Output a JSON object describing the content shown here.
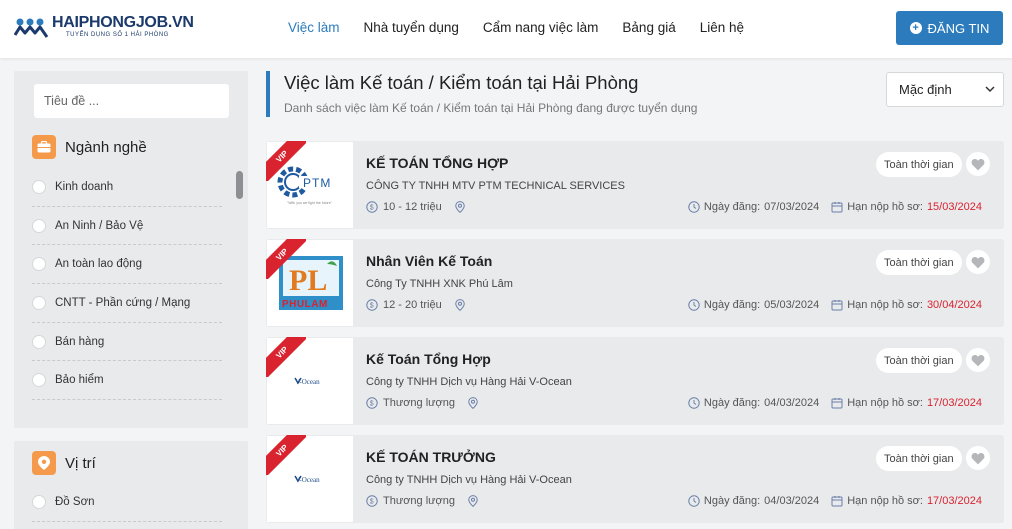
{
  "brand": {
    "name": "HAIPHONGJOB.VN",
    "tagline": "TUYỂN DỤNG SỐ 1 HẢI PHÒNG",
    "accent": "#2b7bbd",
    "navy": "#1b3a6b"
  },
  "nav": {
    "items": [
      {
        "label": "Việc làm",
        "active": true
      },
      {
        "label": "Nhà tuyển dụng",
        "active": false
      },
      {
        "label": "Cẩm nang việc làm",
        "active": false
      },
      {
        "label": "Bảng giá",
        "active": false
      },
      {
        "label": "Liên hệ",
        "active": false
      }
    ],
    "post_button": "ĐĂNG TIN",
    "post_icon": "plus-circle-icon"
  },
  "sidebar": {
    "search": {
      "placeholder": "Tiêu đề ...",
      "value": ""
    },
    "industry": {
      "title": "Ngành nghề",
      "icon": "briefcase-icon",
      "options": [
        "Kinh doanh",
        "An Ninh / Bảo Vệ",
        "An toàn lao động",
        "CNTT - Phần cứng / Mạng",
        "Bán hàng",
        "Bảo hiểm"
      ]
    },
    "location": {
      "title": "Vị trí",
      "icon": "location-pin-icon",
      "options": [
        "Đồ Sơn"
      ]
    }
  },
  "main": {
    "title": "Việc làm Kế toán / Kiểm toán tại Hải Phòng",
    "subtitle": "Danh sách việc làm Kế toán / Kiểm toán tại Hải Phòng đang được tuyển dụng",
    "sort": {
      "selected": "Mặc định"
    },
    "vip_label": "VIP",
    "jobs": [
      {
        "title": "KẾ TOÁN TỔNG HỢP",
        "company": "CÔNG TY TNHH MTV PTM TECHNICAL SERVICES",
        "salary": "10 - 12 triệu",
        "posted_label": "Ngày đăng:",
        "posted": "07/03/2024",
        "deadline_label": "Hạn nộp hồ sơ:",
        "deadline": "15/03/2024",
        "type": "Toàn thời gian",
        "logo": {
          "kind": "ptm",
          "text": "PTM",
          "slogan": "\"With you we fight the future\""
        }
      },
      {
        "title": "Nhân Viên Kế Toán",
        "company": "Công Ty TNHH XNK Phú Lâm",
        "salary": "12 - 20 triệu",
        "posted_label": "Ngày đăng:",
        "posted": "05/03/2024",
        "deadline_label": "Hạn nộp hồ sơ:",
        "deadline": "30/04/2024",
        "type": "Toàn thời gian",
        "logo": {
          "kind": "phulam",
          "text": "PL",
          "slogan": "PHULAM"
        }
      },
      {
        "title": "Kế Toán Tổng Hợp",
        "company": "Công ty TNHH Dịch vụ Hàng Hải V-Ocean",
        "salary": "Thương lượng",
        "posted_label": "Ngày đăng:",
        "posted": "04/03/2024",
        "deadline_label": "Hạn nộp hồ sơ:",
        "deadline": "17/03/2024",
        "type": "Toàn thời gian",
        "logo": {
          "kind": "vocean",
          "text": "V-Ocean",
          "slogan": ""
        }
      },
      {
        "title": "KẾ TOÁN TRƯỞNG",
        "company": "Công ty TNHH Dịch vụ Hàng Hải V-Ocean",
        "salary": "Thương lượng",
        "posted_label": "Ngày đăng:",
        "posted": "04/03/2024",
        "deadline_label": "Hạn nộp hồ sơ:",
        "deadline": "17/03/2024",
        "type": "Toàn thời gian",
        "logo": {
          "kind": "vocean",
          "text": "V-Ocean",
          "slogan": ""
        }
      }
    ]
  }
}
